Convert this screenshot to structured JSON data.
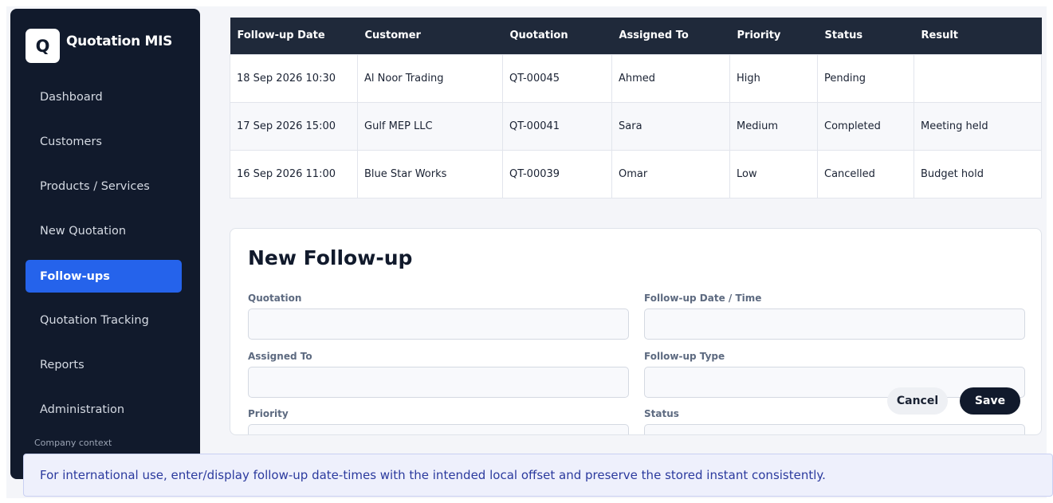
{
  "app": {
    "logo_letter": "Q",
    "title": "Quotation MIS"
  },
  "sidebar": {
    "items": [
      {
        "label": "Dashboard",
        "active": false
      },
      {
        "label": "Customers",
        "active": false
      },
      {
        "label": "Products / Services",
        "active": false
      },
      {
        "label": "New Quotation",
        "active": false
      },
      {
        "label": "Follow-ups",
        "active": true
      },
      {
        "label": "Quotation Tracking",
        "active": false
      },
      {
        "label": "Reports",
        "active": false
      },
      {
        "label": "Administration",
        "active": false
      }
    ],
    "company_context": "Company context"
  },
  "table": {
    "headers": [
      "Follow-up Date",
      "Customer",
      "Quotation",
      "Assigned To",
      "Priority",
      "Status",
      "Result"
    ],
    "rows": [
      [
        "18 Sep 2026 10:30",
        "Al Noor Trading",
        "QT-00045",
        "Ahmed",
        "High",
        "Pending",
        ""
      ],
      [
        "17 Sep 2026 15:00",
        "Gulf MEP LLC",
        "QT-00041",
        "Sara",
        "Medium",
        "Completed",
        "Meeting held"
      ],
      [
        "16 Sep 2026 11:00",
        "Blue Star Works",
        "QT-00039",
        "Omar",
        "Low",
        "Cancelled",
        "Budget hold"
      ]
    ]
  },
  "form": {
    "title": "New Follow-up",
    "fields": {
      "quotation": {
        "label": "Quotation",
        "value": ""
      },
      "followup_datetime": {
        "label": "Follow-up Date / Time",
        "value": ""
      },
      "assigned_to": {
        "label": "Assigned To",
        "value": ""
      },
      "followup_type": {
        "label": "Follow-up Type",
        "value": ""
      },
      "priority": {
        "label": "Priority",
        "value": ""
      },
      "status": {
        "label": "Status",
        "value": ""
      }
    },
    "cancel_label": "Cancel",
    "save_label": "Save"
  },
  "notice": {
    "text": "For international use, enter/display follow-up date-times with the intended local offset and preserve the stored instant consistently."
  },
  "colors": {
    "sidebar_bg": "#111a2c",
    "accent": "#2563eb",
    "table_header_bg": "#1f293a",
    "notice_text": "#2b3a9e"
  }
}
